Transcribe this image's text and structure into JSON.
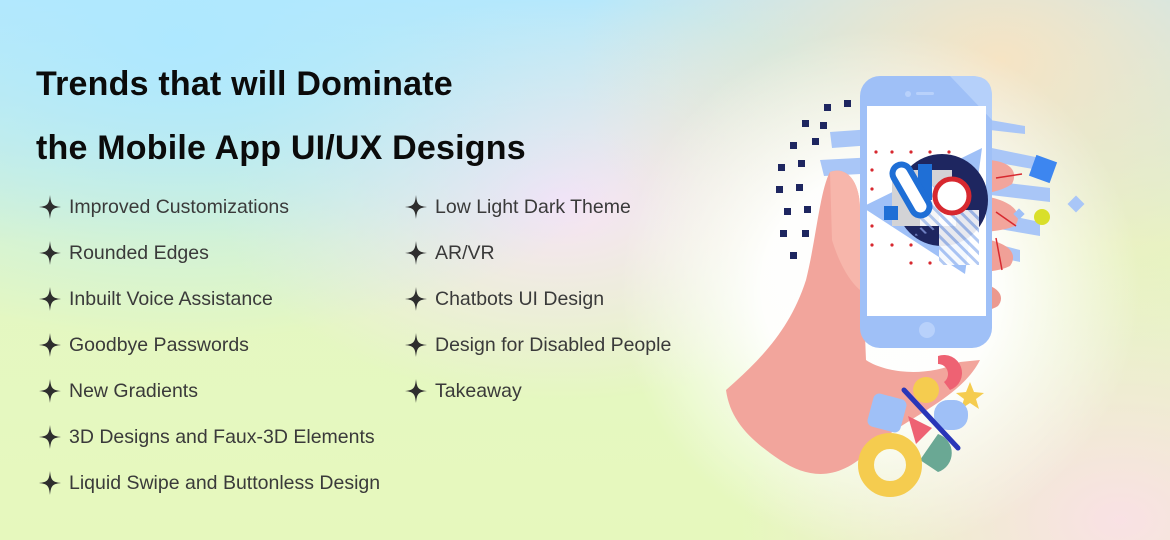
{
  "title": {
    "line1": "Trends that will Dominate",
    "line2": "the Mobile App UI/UX Designs"
  },
  "bullet_icon": "four-point-star-icon",
  "trends_left": [
    {
      "label": "Improved Customizations"
    },
    {
      "label": "Rounded Edges"
    },
    {
      "label": "Inbuilt Voice Assistance"
    },
    {
      "label": "Goodbye Passwords"
    },
    {
      "label": "New Gradients"
    },
    {
      "label": "3D Designs and Faux-3D Elements"
    },
    {
      "label": "Liquid Swipe and Buttonless Design"
    }
  ],
  "trends_right": [
    {
      "label": "Low Light Dark Theme"
    },
    {
      "label": "AR/VR"
    },
    {
      "label": "Chatbots UI Design"
    },
    {
      "label": "Design for Disabled People"
    },
    {
      "label": "Takeaway"
    }
  ],
  "illustration": {
    "subject": "hand-holding-smartphone",
    "colors": {
      "phone": "#9fc0f7",
      "hand": "#f2a59c",
      "navy": "#1e2660",
      "red": "#d7282f",
      "blue": "#1f6fd6",
      "yellow": "#f5cc4f"
    }
  }
}
